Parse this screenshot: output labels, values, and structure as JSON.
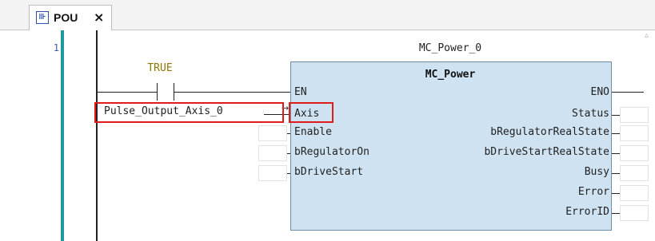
{
  "tab": {
    "title": "POU",
    "icon": "ladder-pou-icon",
    "close_symbol": "×"
  },
  "editor": {
    "line_number": "1",
    "contact": {
      "variable": "TRUE"
    },
    "function_block": {
      "instance_name": "MC_Power_0",
      "type_name": "MC_Power",
      "inputs": [
        "EN",
        "Axis",
        "Enable",
        "bRegulatorOn",
        "bDriveStart"
      ],
      "outputs": [
        "ENO",
        "Status",
        "bRegulatorRealState",
        "bDriveStartRealState",
        "Busy",
        "Error",
        "ErrorID"
      ]
    },
    "axis_variable": "Pulse_Output_Axis_0"
  },
  "colors": {
    "gutter_bar": "#1e9a9a",
    "fb_fill": "#cfe2f1",
    "highlight": "#e01b1b",
    "contact_label": "#8a7a00"
  }
}
